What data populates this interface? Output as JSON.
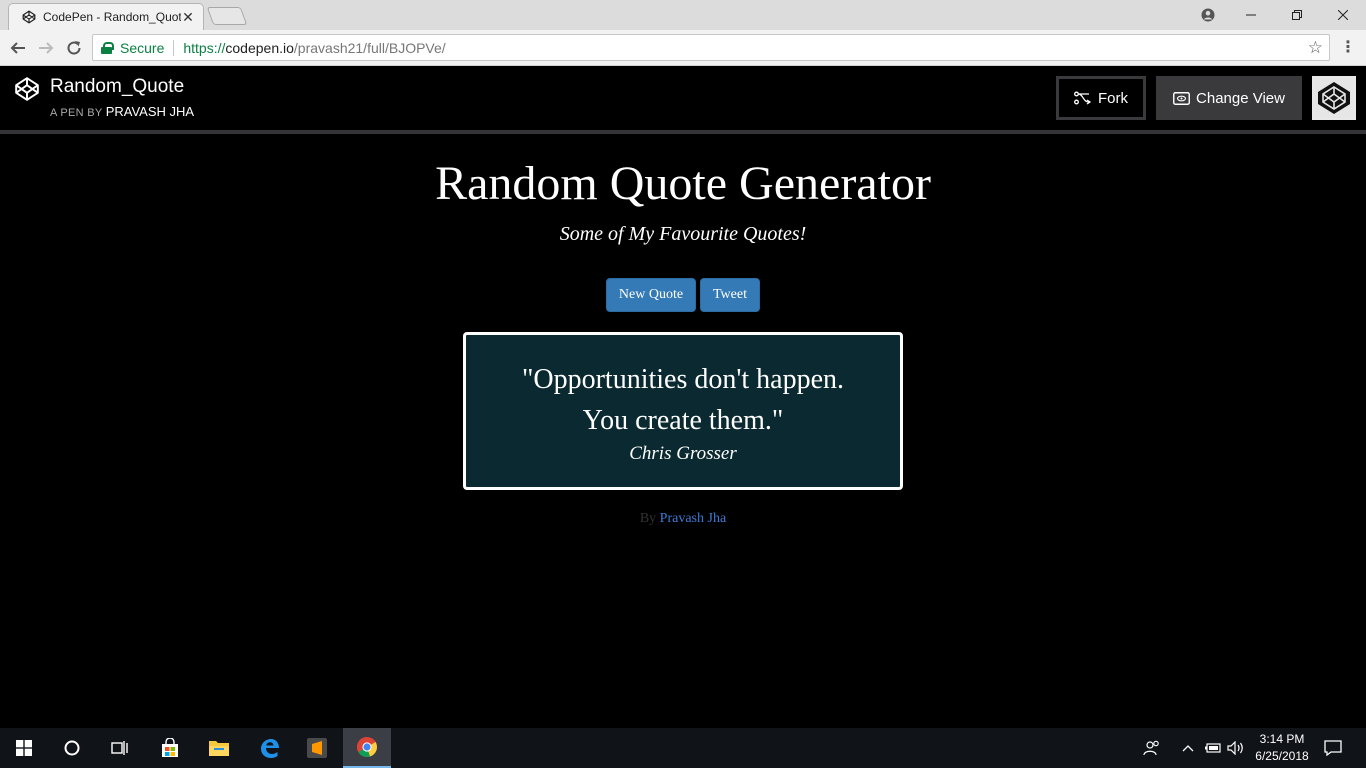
{
  "browser": {
    "tab_title": "CodePen - Random_Quot",
    "close_glyph": "✕",
    "secure_label": "Secure",
    "url_proto": "https://",
    "url_host": "codepen.io",
    "url_path": "/pravash21/full/BJOPVe/"
  },
  "codepen": {
    "pen_title": "Random_Quote",
    "byline_prefix": "A PEN BY",
    "author": "PRAVASH JHA",
    "fork_label": "Fork",
    "change_view_label": "Change View"
  },
  "page": {
    "title": "Random Quote Generator",
    "subtitle": "Some of My Favourite Quotes!",
    "new_quote_label": "New Quote",
    "tweet_label": "Tweet",
    "quote_line1": "\"Opportunities don't happen.",
    "quote_line2": "You create them.\"",
    "quote_author": "Chris Grosser",
    "credit_prefix": "By",
    "credit_author": "Pravash Jha"
  },
  "taskbar": {
    "time": "3:14 PM",
    "date": "6/25/2018"
  },
  "colors": {
    "button_blue": "#337ab7",
    "quote_box_bg": "#0a2930",
    "secure_green": "#0b8043",
    "link_blue": "#3a7bd5"
  }
}
